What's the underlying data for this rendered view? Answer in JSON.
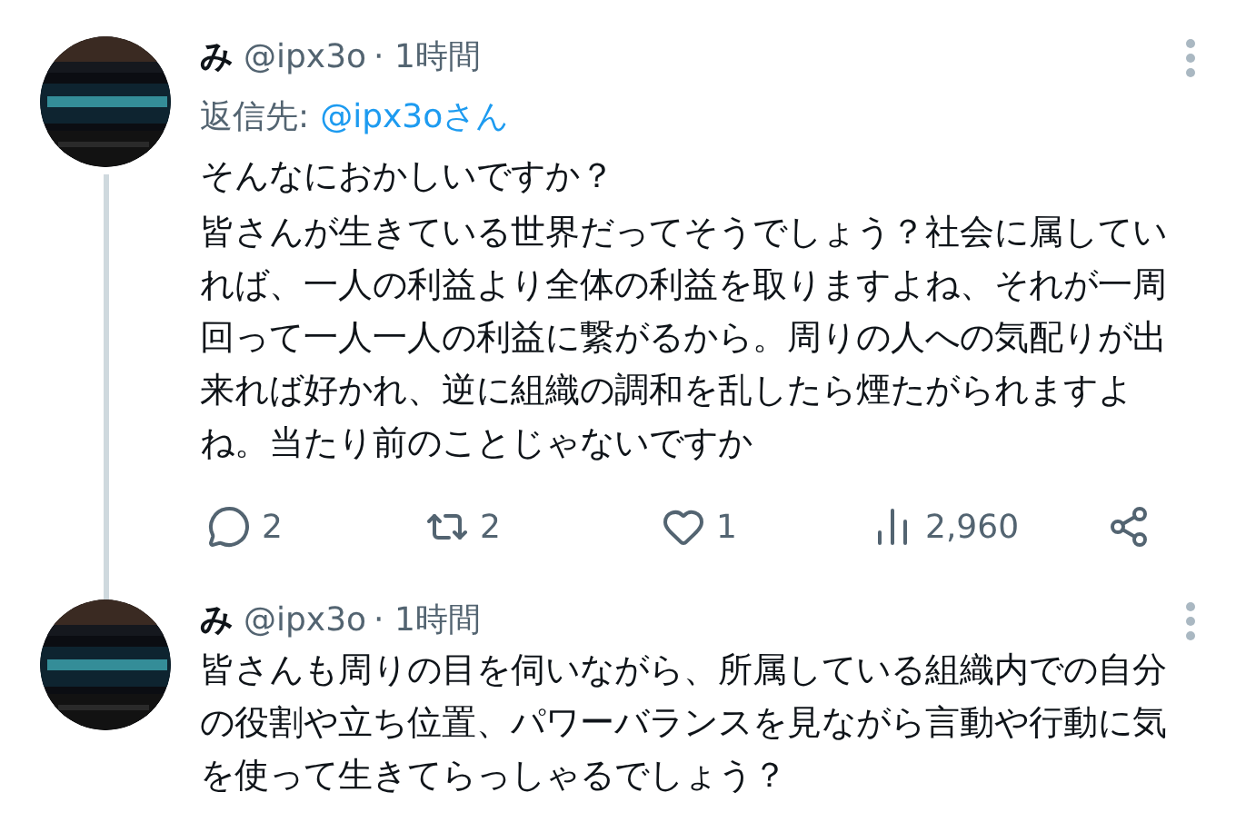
{
  "tweets": [
    {
      "name": "み",
      "handle": "@ipx3o",
      "time": "· 1時間",
      "reply_to": {
        "label": "返信先:",
        "target": "@ipx3oさん"
      },
      "paragraphs": [
        "そんなにおかしいですか？",
        "皆さんが生きている世界だってそうでしょう？社会に属していれば、一人の利益より全体の利益を取りますよね、それが一周回って一人一人の利益に繋がるから。周りの人への気配りが出来れば好かれ、逆に組織の調和を乱したら煙たがられますよね。当たり前のことじゃないですか"
      ],
      "actions": [
        {
          "kind": "reply",
          "count": "2"
        },
        {
          "kind": "retweet",
          "count": "2"
        },
        {
          "kind": "like",
          "count": "1"
        },
        {
          "kind": "views",
          "count": "2,960"
        },
        {
          "kind": "share"
        }
      ],
      "thread_line": true
    },
    {
      "name": "み",
      "handle": "@ipx3o",
      "time": "· 1時間",
      "paragraphs": [
        "皆さんも周りの目を伺いながら、所属している組織内での自分の役割や立ち位置、パワーバランスを見ながら言動や行動に気を使って生きてらっしゃるでしょう？"
      ],
      "thread_line": false
    }
  ]
}
